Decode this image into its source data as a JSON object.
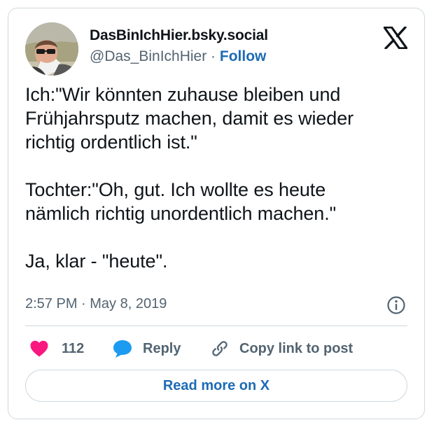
{
  "author": {
    "display_name": "DasBinIchHier.bsky.social",
    "handle": "@Das_BinIchHier",
    "separator": " · ",
    "follow_label": "Follow"
  },
  "tweet": {
    "text": "Ich:\"Wir könnten zuhause bleiben und\nFrühjahrsputz machen, damit es wieder\nrichtig ordentlich ist.\"\n\nTochter:\"Oh, gut. Ich wollte es heute\nnämlich richtig unordentlich machen.\"\n\nJa, klar - \"heute\".",
    "timestamp": "2:57 PM · May 8, 2019"
  },
  "actions": {
    "like_count": "112",
    "reply_label": "Reply",
    "copy_label": "Copy link to post"
  },
  "footer": {
    "read_more_label": "Read more on X"
  },
  "icons": {
    "like": "heart-icon",
    "reply": "speech-bubble-icon",
    "copy": "link-icon",
    "info": "info-icon",
    "brand": "x-logo-icon"
  },
  "colors": {
    "heart": "#f91880",
    "reply": "#1d9bf0",
    "link_text": "#1d6bb5",
    "secondary_text": "#536471",
    "border": "#cfd9de"
  }
}
